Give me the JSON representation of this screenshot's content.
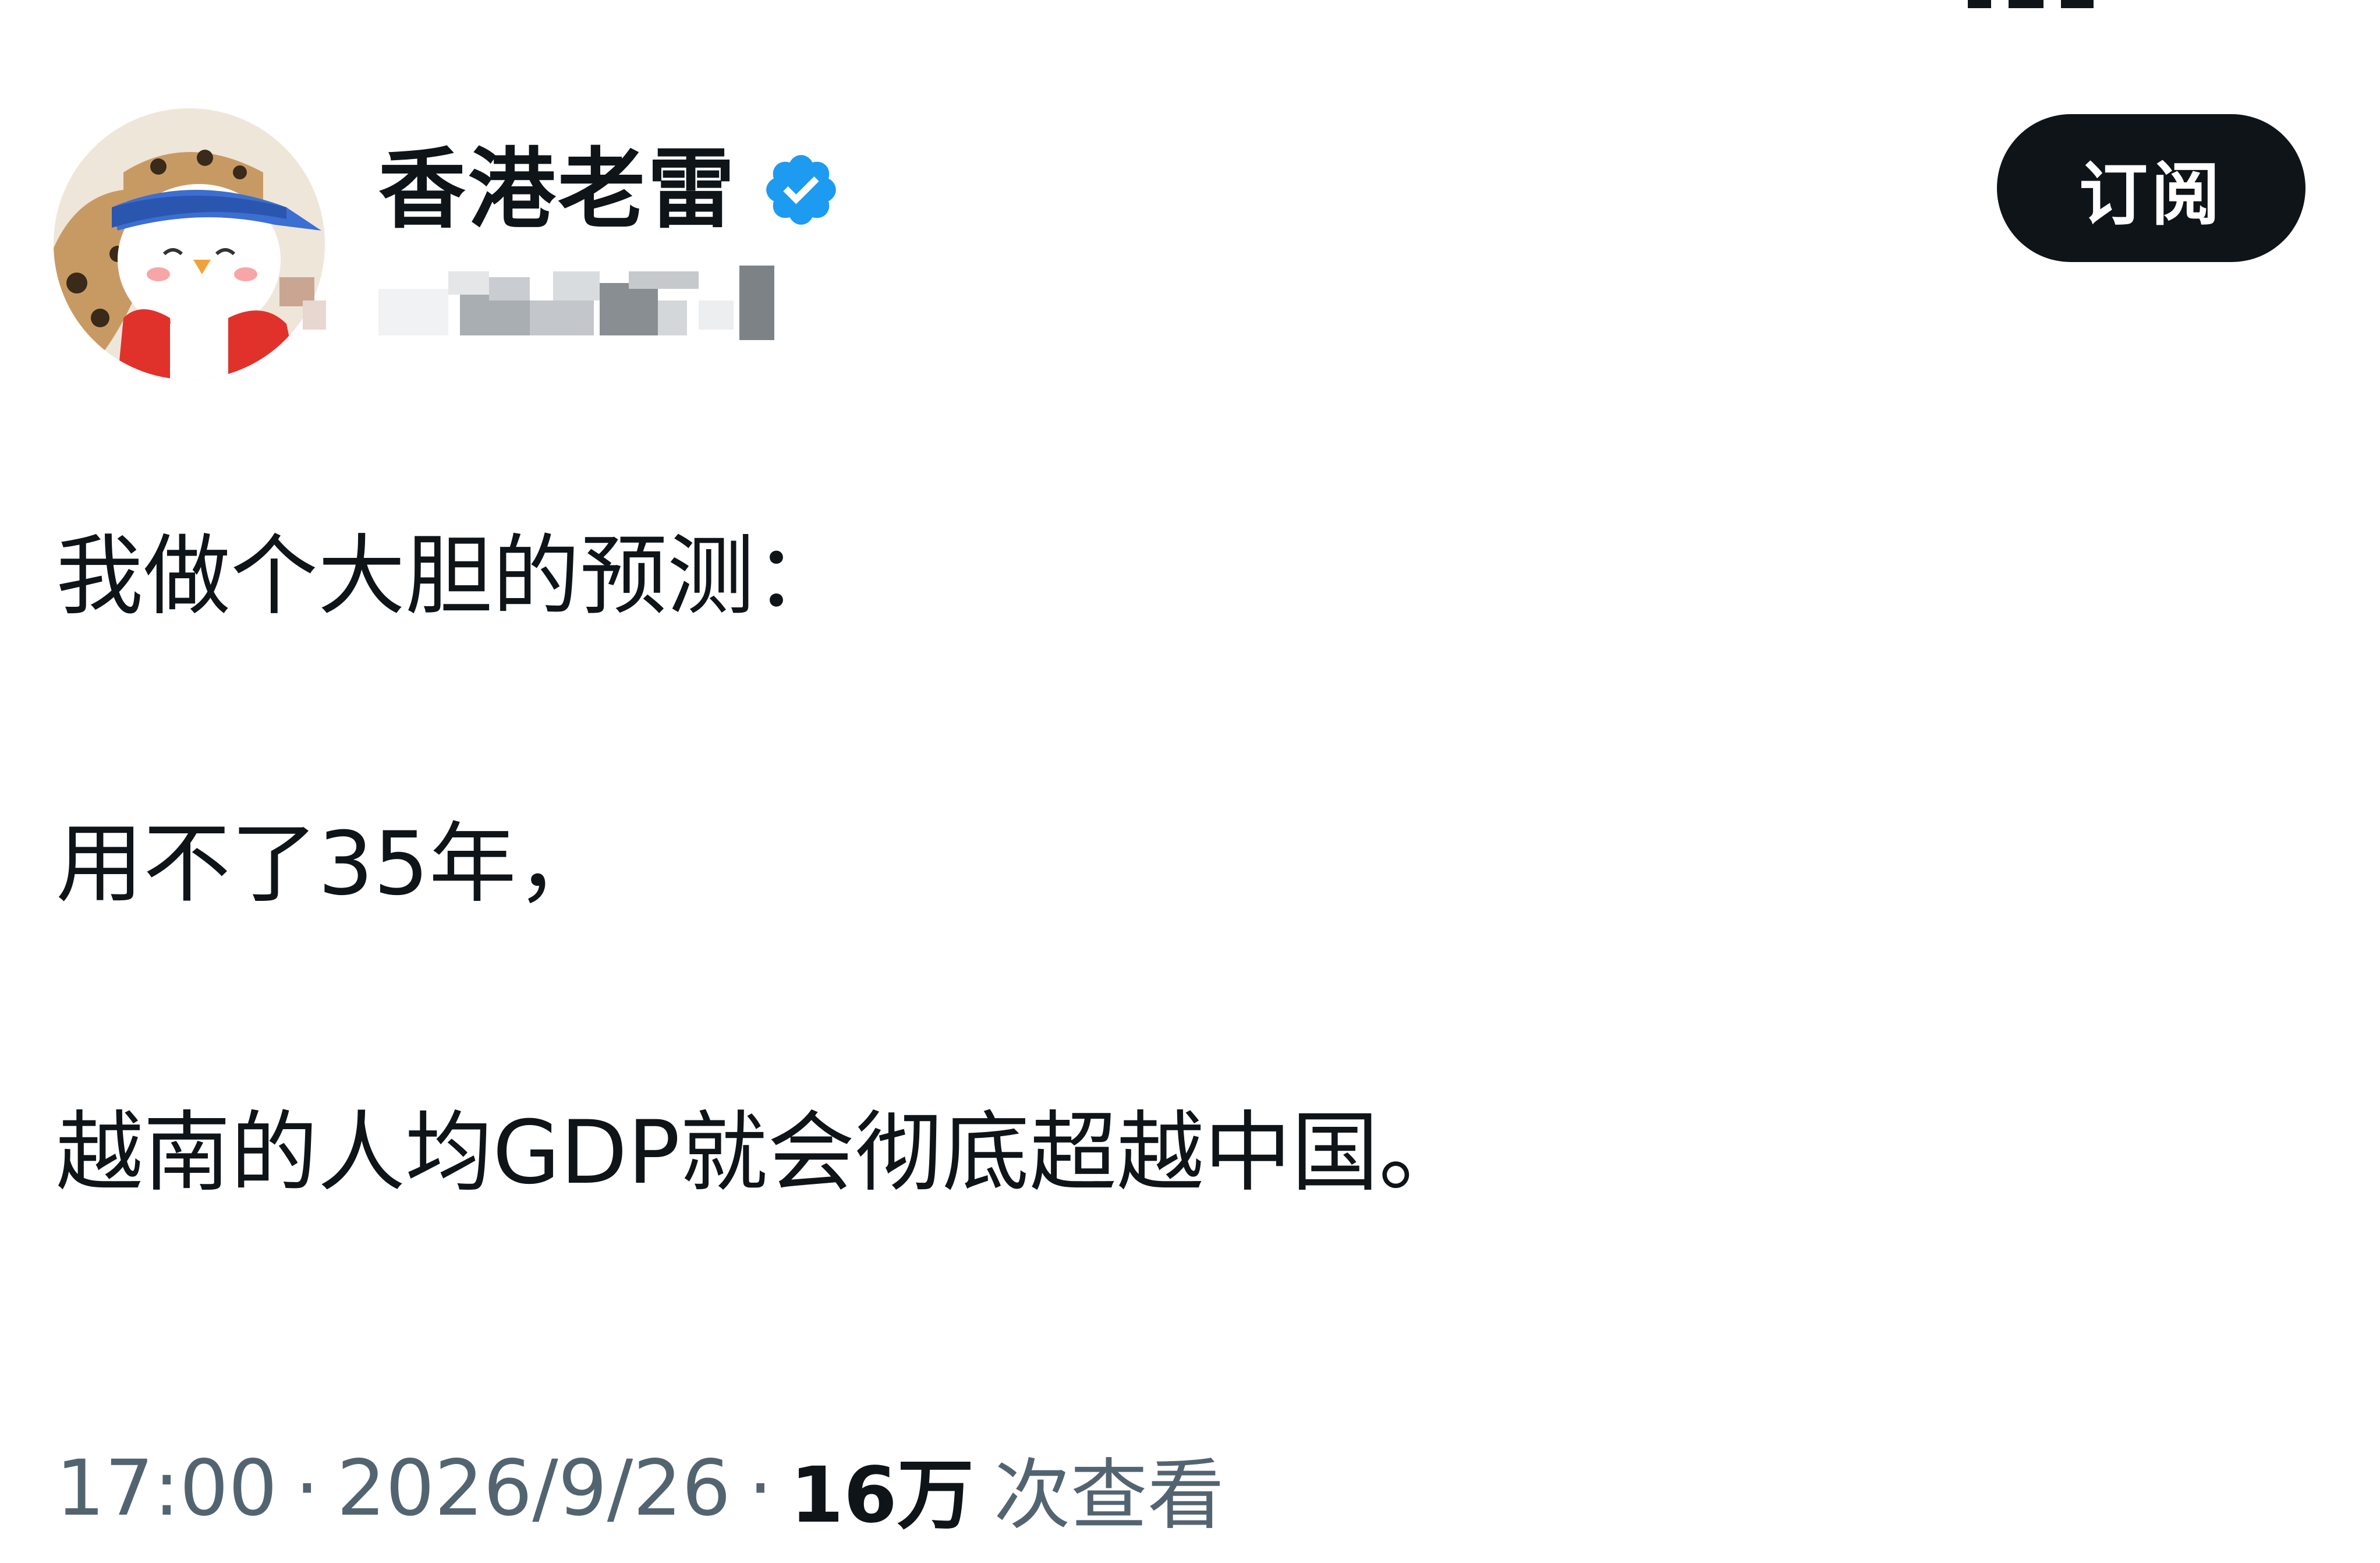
{
  "colors": {
    "text_primary": "#0f1419",
    "text_secondary": "#536471",
    "verified_blue": "#1d9bf0",
    "button_bg": "#0f1419",
    "button_text": "#ffffff",
    "background": "#ffffff"
  },
  "header": {
    "display_name": "香港老雷",
    "verified_icon": "verified-badge-icon",
    "handle_obscured": true,
    "subscribe_label": "订阅"
  },
  "tweet": {
    "lines": [
      "我做个大胆的预测：",
      "用不了35年，",
      "越南的人均GDP就会彻底超越中国。"
    ]
  },
  "meta": {
    "time": "17:00",
    "separator": "·",
    "date": "2026/9/26",
    "view_count": "16万",
    "view_label": "次查看"
  }
}
